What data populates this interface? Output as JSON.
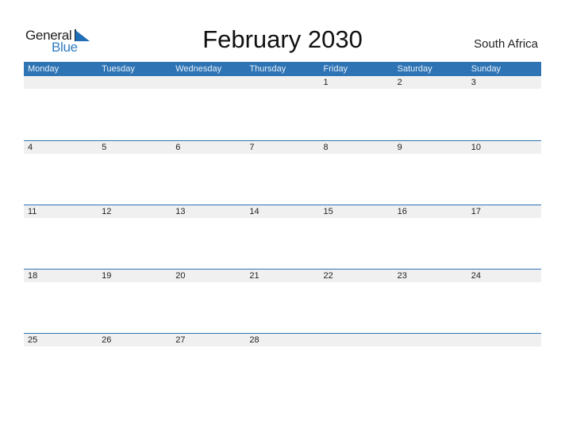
{
  "logo": {
    "text_top": "General",
    "text_bottom": "Blue"
  },
  "title": "February 2030",
  "country": "South Africa",
  "colors": {
    "header_bg": "#2E74B5",
    "date_strip_bg": "#F0F0F0",
    "logo_blue": "#2F7CC4"
  },
  "weekdays": [
    "Monday",
    "Tuesday",
    "Wednesday",
    "Thursday",
    "Friday",
    "Saturday",
    "Sunday"
  ],
  "weeks": [
    [
      "",
      "",
      "",
      "",
      "1",
      "2",
      "3"
    ],
    [
      "4",
      "5",
      "6",
      "7",
      "8",
      "9",
      "10"
    ],
    [
      "11",
      "12",
      "13",
      "14",
      "15",
      "16",
      "17"
    ],
    [
      "18",
      "19",
      "20",
      "21",
      "22",
      "23",
      "24"
    ],
    [
      "25",
      "26",
      "27",
      "28",
      "",
      "",
      ""
    ]
  ]
}
